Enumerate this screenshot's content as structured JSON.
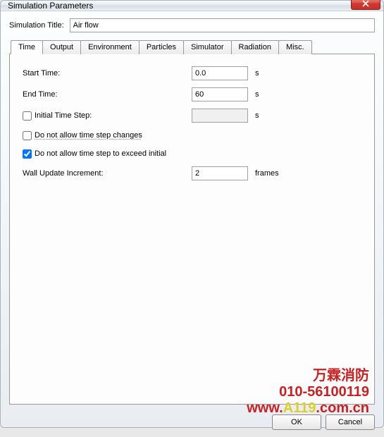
{
  "window": {
    "title": "Simulation Parameters"
  },
  "titleRow": {
    "label": "Simulation Title:",
    "value": "Air flow"
  },
  "tabs": {
    "time": "Time",
    "output": "Output",
    "environment": "Environment",
    "particles": "Particles",
    "simulator": "Simulator",
    "radiation": "Radiation",
    "misc": "Misc."
  },
  "timeTab": {
    "startTime": {
      "label": "Start Time:",
      "value": "0.0",
      "unit": "s"
    },
    "endTime": {
      "label": "End Time:",
      "value": "60",
      "unit": "s"
    },
    "initialStep": {
      "label": "Initial Time Step:",
      "checked": false,
      "value": "",
      "unit": "s"
    },
    "noStepChanges": {
      "label": "Do not allow time step changes",
      "checked": false
    },
    "noExceedInitial": {
      "label": "Do not allow time step to exceed initial",
      "checked": true
    },
    "wallUpdate": {
      "label": "Wall Update Increment:",
      "value": "2",
      "unit": "frames"
    }
  },
  "buttons": {
    "ok": "OK",
    "cancel": "Cancel"
  },
  "watermark": {
    "line1": "万霖消防",
    "line2": "010-56100119",
    "line3a": "www.",
    "line3b": "A119",
    "line3c": ".com.cn"
  }
}
